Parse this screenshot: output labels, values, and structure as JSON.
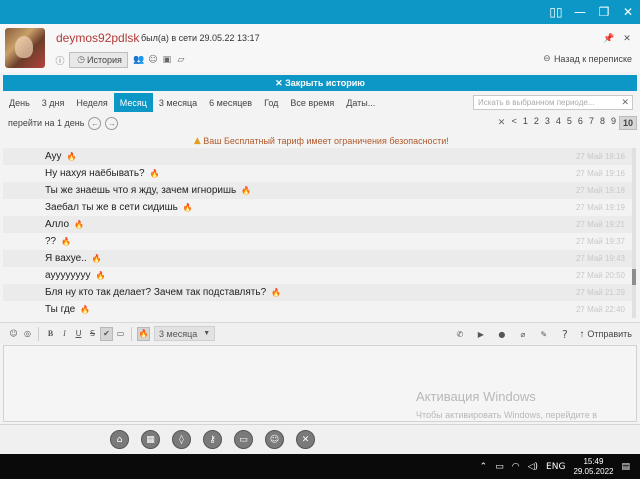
{
  "window": {
    "buttons": [
      {
        "name": "window-split-icon",
        "glyph": "▯▯"
      },
      {
        "name": "minimize-icon",
        "glyph": "—"
      },
      {
        "name": "restore-icon",
        "glyph": "❐"
      },
      {
        "name": "close-icon",
        "glyph": "✕"
      }
    ]
  },
  "contact": {
    "username": "deymos92pdlsk",
    "last_seen": "был(а) в сети 29.05.22 13:17"
  },
  "header": {
    "history_label": "История",
    "back_label": "Назад к переписке"
  },
  "closebar": {
    "label": "✕ Закрыть историю"
  },
  "period_tabs": [
    "День",
    "3 дня",
    "Неделя",
    "Месяц",
    "3 месяца",
    "6 месяцев",
    "Год",
    "Все время",
    "Даты..."
  ],
  "active_tab": "Месяц",
  "search": {
    "placeholder": "Искать в выбранном периоде..."
  },
  "nav": {
    "goto_label": "перейти на 1 день",
    "pages": [
      "<",
      "1",
      "2",
      "3",
      "4",
      "5",
      "6",
      "7",
      "8",
      "9",
      "10"
    ],
    "current_page": "10"
  },
  "warning": {
    "text": "Ваш Бесплатный тариф имеет ограничения безопасности!"
  },
  "messages": [
    {
      "text": "Ауу",
      "time": "27 Май 19:16"
    },
    {
      "text": "Ну нахуя наёбывать?",
      "time": "27 Май 19:16"
    },
    {
      "text": "Ты же знаешь что я жду, зачем игноришь",
      "time": "27 Май 19:18"
    },
    {
      "text": "Заебал ты же в сети сидишь",
      "time": "27 Май 19:19"
    },
    {
      "text": "Алло",
      "time": "27 Май 19:21"
    },
    {
      "text": "??",
      "time": "27 Май 19:37"
    },
    {
      "text": "Я вахуе..",
      "time": "27 Май 19:43"
    },
    {
      "text": "ayyyyyyyy",
      "time": "27 Май 20:50"
    },
    {
      "text": "Бля ну кто так делает? Зачем так подставлять?",
      "time": "27 Май 21:29"
    },
    {
      "text": "Ты где",
      "time": "27 Май 22:40"
    }
  ],
  "composer": {
    "period_select": "3 месяца",
    "send_label": "Отправить"
  },
  "watermark": {
    "title": "Активация Windows",
    "text": "Чтобы активировать Windows, перейдите в раздел \"Параметры\"."
  },
  "taskbar": {
    "lang": "ENG",
    "time": "15:49",
    "date": "29.05.2022"
  }
}
